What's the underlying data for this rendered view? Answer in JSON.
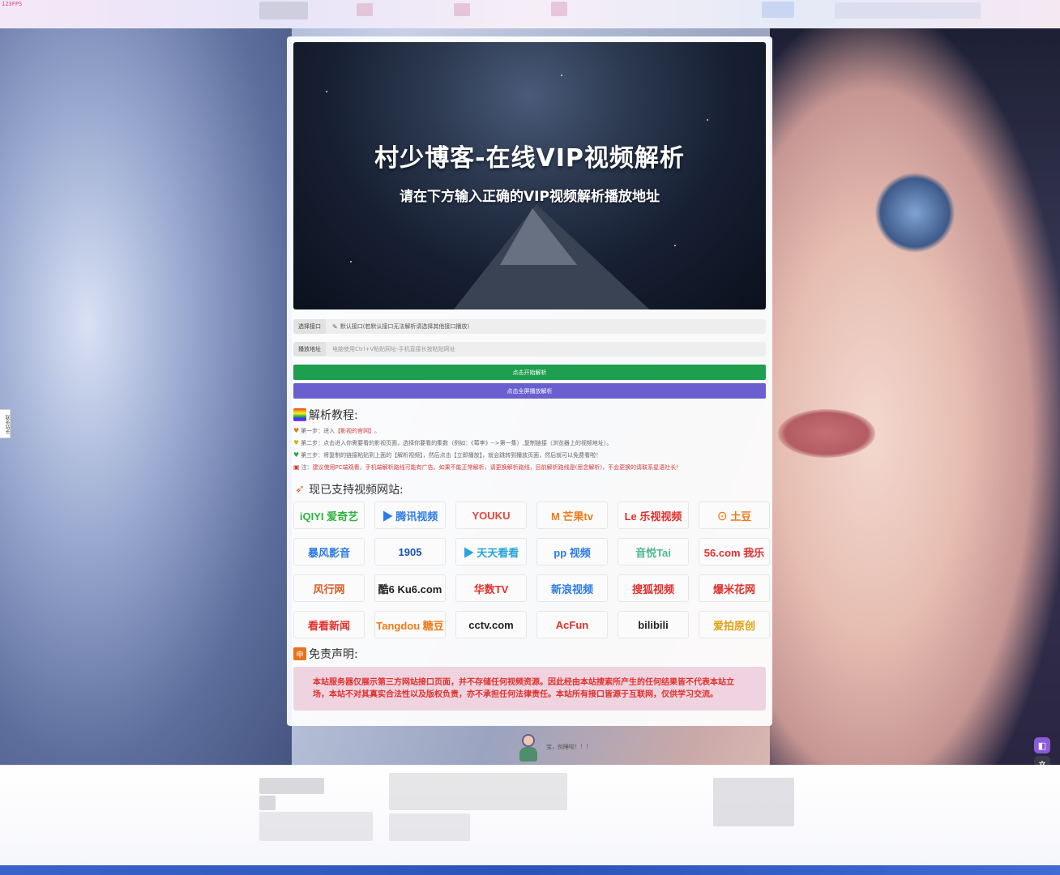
{
  "topbar": {
    "fps": "123FPS"
  },
  "side_tab": {
    "label": "联系站长"
  },
  "hero": {
    "title": "村少博客-在线VIP视频解析",
    "subtitle": "请在下方输入正确的VIP视频解析播放地址"
  },
  "form": {
    "interface_label": "选择接口",
    "interface_value": "默认接口(若默认接口无法解析请选择其他接口播放)",
    "url_label": "播放地址",
    "url_placeholder": "电脑使用Ctrl+V粘贴网址-手机直接长按粘贴网址",
    "url_value": "",
    "parse_button": "点击开始解析",
    "fullscreen_button": "点击全屏播放解析"
  },
  "tutorial": {
    "title": "解析教程:",
    "steps": [
      {
        "prefix": "第一步：进入",
        "highlight": "【影视的官网】",
        "suffix": "。"
      },
      {
        "prefix": "第二步：点击进入你需要看的影视页面，选择你要看的集数（例如：《莓李》-->第一集）,复制链接（浏览器上的视频地址）。",
        "highlight": "",
        "suffix": ""
      },
      {
        "prefix": "第三步：将复制的链接粘贴到上面的【解析视频】，然后点击【立即播放】，就会跳转到播放页面，然后就可以免费看啦！",
        "highlight": "",
        "suffix": ""
      },
      {
        "prefix": "注：",
        "highlight": "建议使用PC端观看，手机端解析路线可能有广告。如果不能正常解析，请更换解析路线，目前解析路线是(思念解析)，不会更换的请联系星语社长！",
        "suffix": ""
      }
    ]
  },
  "supported": {
    "title": "现已支持视频网站:",
    "sites": [
      {
        "name": "爱奇艺",
        "label": "iQIYI 爱奇艺",
        "color": "#2fb340"
      },
      {
        "name": "腾讯视频",
        "label": "▶ 腾讯视频",
        "color": "#2b7be5"
      },
      {
        "name": "优酷",
        "label": "YOUKU",
        "color": "#e8463a"
      },
      {
        "name": "芒果tv",
        "label": "M 芒果tv",
        "color": "#f07a18"
      },
      {
        "name": "乐视视频",
        "label": "Le 乐视视频",
        "color": "#e0302c"
      },
      {
        "name": "土豆",
        "label": "⊙ 土豆",
        "color": "#f07a18"
      },
      {
        "name": "暴风影音",
        "label": "暴风影音",
        "color": "#2b7be5"
      },
      {
        "name": "1905",
        "label": "1905",
        "color": "#1a4fb5"
      },
      {
        "name": "天天看看",
        "label": "▶ 天天看看",
        "color": "#27a5d8"
      },
      {
        "name": "PPTV",
        "label": "pp 视频",
        "color": "#2b7be5"
      },
      {
        "name": "音悦Tai",
        "label": "音悦Tai",
        "color": "#4fb88f"
      },
      {
        "name": "56我乐",
        "label": "56.com 我乐",
        "color": "#e0302c"
      },
      {
        "name": "风行网",
        "label": "风行网",
        "color": "#e05a24"
      },
      {
        "name": "酷6",
        "label": "酷6 Ku6.com",
        "color": "#222222"
      },
      {
        "name": "华数TV",
        "label": "华数TV",
        "color": "#e0302c"
      },
      {
        "name": "新浪视频",
        "label": "新浪视频",
        "color": "#2b7be5"
      },
      {
        "name": "搜狐视频",
        "label": "搜狐视频",
        "color": "#e0302c"
      },
      {
        "name": "爆米花网",
        "label": "爆米花网",
        "color": "#e0302c"
      },
      {
        "name": "看看新闻",
        "label": "看看新闻",
        "color": "#e0302c"
      },
      {
        "name": "糖豆",
        "label": "Tangdou 糖豆",
        "color": "#f07a18"
      },
      {
        "name": "央视网",
        "label": "cctv.com",
        "color": "#222222"
      },
      {
        "name": "AcFun",
        "label": "AcFun",
        "color": "#e0302c"
      },
      {
        "name": "bilibili",
        "label": "bilibili",
        "color": "#222222"
      },
      {
        "name": "爱拍原创",
        "label": "爱拍原创",
        "color": "#e0a010"
      }
    ]
  },
  "disclaimer": {
    "title": "免责声明:",
    "text": "本站服务器仅展示第三方网站接口页面，并不存储任何视频资源。因此经由本站搜索所产生的任何结果皆不代表本站立场，本站不对其真实合法性以及版权负责，亦不承担任何法律责任。本站所有接口皆源于互联网，仅供学习交流。"
  },
  "mascot": {
    "text": "宝，别睡啦！！！"
  },
  "colors": {
    "green": "#1e9e4f",
    "purple": "#6a5fcf",
    "warn": "#d23a3a"
  }
}
